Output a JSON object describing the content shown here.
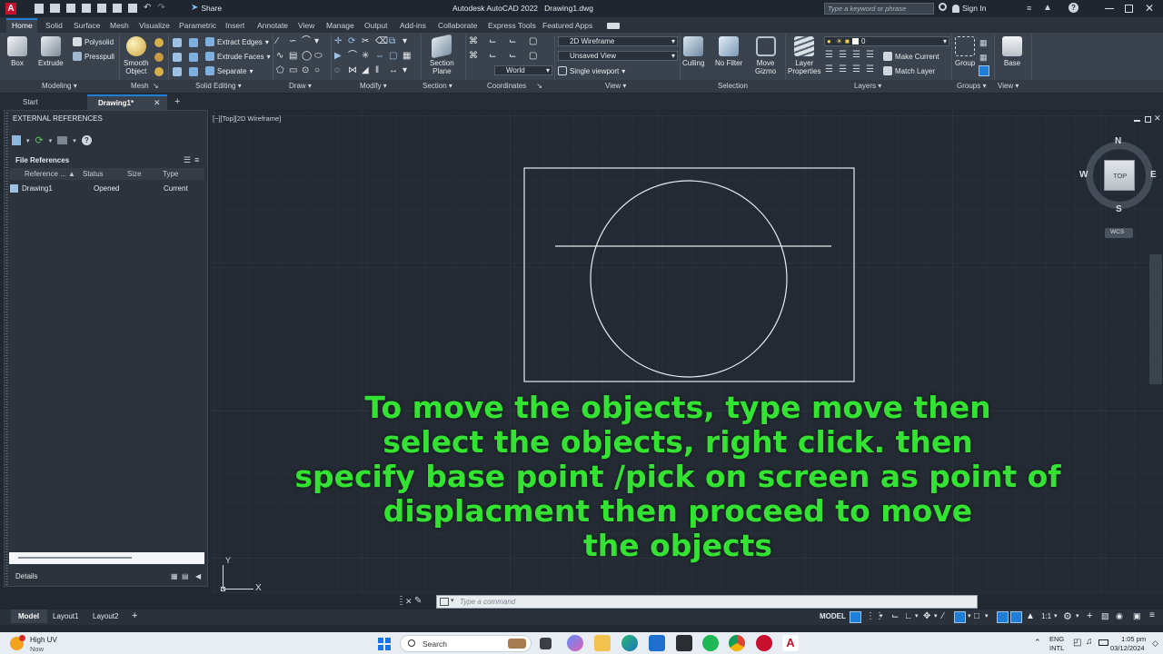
{
  "app": {
    "title": "Autodesk AutoCAD 2022",
    "filename": "Drawing1.dwg",
    "share_label": "Share",
    "search_placeholder": "Type a keyword or phrase",
    "sign_in": "Sign In"
  },
  "ribbon_tabs": [
    "Home",
    "Solid",
    "Surface",
    "Mesh",
    "Visualize",
    "Parametric",
    "Insert",
    "Annotate",
    "View",
    "Manage",
    "Output",
    "Add-ins",
    "Collaborate",
    "Express Tools",
    "Featured Apps"
  ],
  "ribbon": {
    "box": "Box",
    "extrude": "Extrude",
    "polysolid": "Polysolid",
    "presspull": "Presspull",
    "smooth_object_1": "Smooth",
    "smooth_object_2": "Object",
    "extract_edges": "Extract Edges",
    "extrude_faces": "Extrude Faces",
    "separate": "Separate",
    "section_plane_1": "Section",
    "section_plane_2": "Plane",
    "visual_style": "2D Wireframe",
    "view_name": "Unsaved View",
    "viewport": "Single viewport",
    "ucs": "World",
    "culling": "Culling",
    "no_filter": "No Filter",
    "move_gizmo_1": "Move",
    "move_gizmo_2": "Gizmo",
    "layer_properties_1": "Layer",
    "layer_properties_2": "Properties",
    "layer_current": "0",
    "make_current": "Make Current",
    "match_layer": "Match Layer",
    "group": "Group",
    "base": "Base"
  },
  "panel_labels": {
    "modeling": "Modeling",
    "mesh": "Mesh",
    "solid_editing": "Solid Editing",
    "draw": "Draw",
    "modify": "Modify",
    "section": "Section",
    "coordinates": "Coordinates",
    "view": "View",
    "selection": "Selection",
    "layers": "Layers",
    "groups": "Groups",
    "view2": "View"
  },
  "doc_tabs": {
    "start": "Start",
    "drawing": "Drawing1*"
  },
  "palette": {
    "title": "EXTERNAL REFERENCES",
    "file_references": "File References",
    "columns": [
      "Reference ...",
      "Status",
      "Size",
      "Type"
    ],
    "row": {
      "name": "Drawing1",
      "status": "Opened",
      "size": "",
      "type": "Current"
    },
    "details": "Details"
  },
  "viewport": {
    "label": "[−][Top][2D Wireframe]",
    "compass_n": "N",
    "compass_s": "S",
    "compass_e": "E",
    "compass_w": "W",
    "viewcube_top": "TOP",
    "wcs": "WCS",
    "axis_y": "Y",
    "axis_x": "X"
  },
  "caption": {
    "line1": "To move the objects, type move then",
    "line2": "select the objects, right click. then",
    "line3": "specify base point /pick on screen as point of",
    "line4": "displacment then proceed to move",
    "line5": "the objects"
  },
  "command": {
    "placeholder": "Type a command"
  },
  "layout_tabs": {
    "model": "Model",
    "layout1": "Layout1",
    "layout2": "Layout2"
  },
  "status": {
    "model": "MODEL",
    "scale": "1:1"
  },
  "taskbar": {
    "weather_title": "High UV",
    "weather_sub": "Now",
    "search": "Search",
    "lang1": "ENG",
    "lang2": "INTL",
    "time": "1:05 pm",
    "date": "03/12/2024"
  },
  "colors": {
    "caption": "#33e233",
    "canvas": "#232a33",
    "ribbon": "#3a424d",
    "accent": "#1f7ed8"
  }
}
